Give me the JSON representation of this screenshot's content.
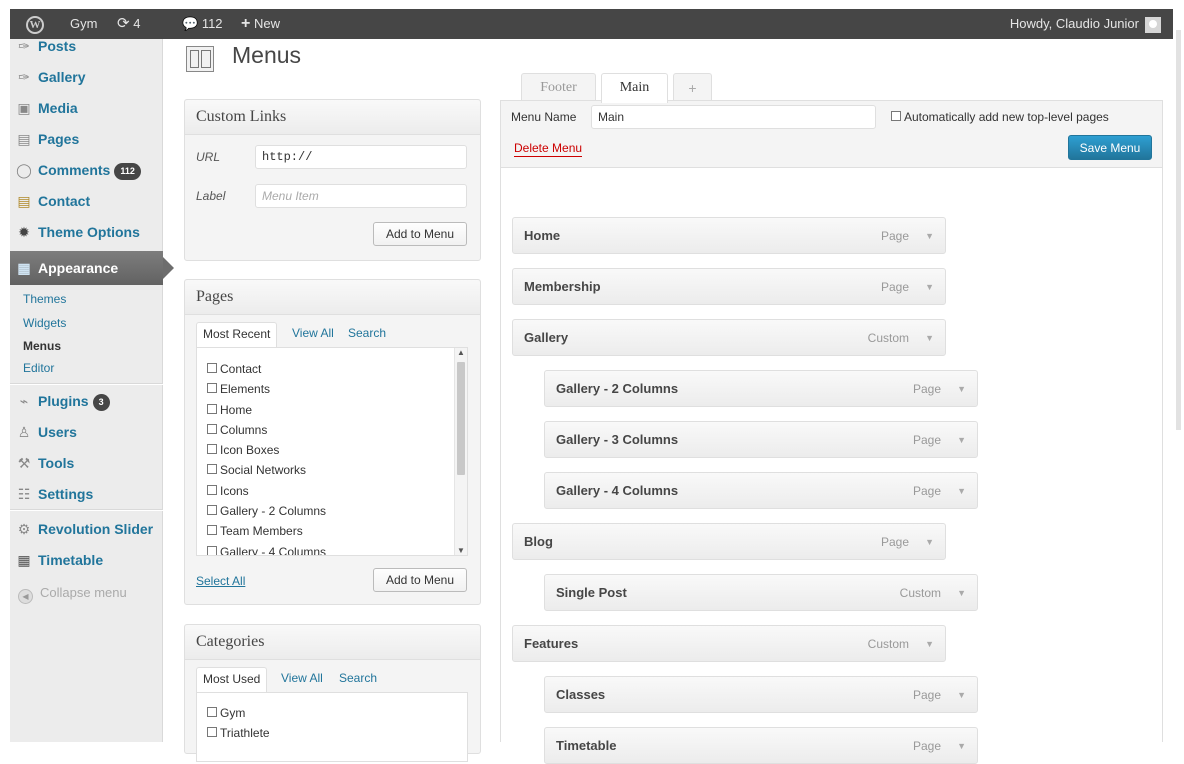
{
  "admin_bar": {
    "site_name": "Gym",
    "updates_count": "4",
    "comments_count": "112",
    "new_label": "New",
    "howdy": "Howdy, Claudio Junior"
  },
  "sidebar": {
    "items": [
      {
        "label": "Posts",
        "icon": "pushpin-icon"
      },
      {
        "label": "Gallery",
        "icon": "pushpin-icon"
      },
      {
        "label": "Media",
        "icon": "media-icon"
      },
      {
        "label": "Pages",
        "icon": "pages-icon"
      },
      {
        "label": "Comments",
        "icon": "comment-icon",
        "badge": "112"
      },
      {
        "label": "Contact",
        "icon": "contact-icon"
      },
      {
        "label": "Theme Options",
        "icon": "gear-icon"
      },
      {
        "label": "Appearance",
        "icon": "appearance-icon"
      },
      {
        "label": "Plugins",
        "icon": "plugin-icon",
        "badge": "3"
      },
      {
        "label": "Users",
        "icon": "users-icon"
      },
      {
        "label": "Tools",
        "icon": "tools-icon"
      },
      {
        "label": "Settings",
        "icon": "settings-icon"
      },
      {
        "label": "Revolution Slider",
        "icon": "cog-icon"
      },
      {
        "label": "Timetable",
        "icon": "calendar-icon"
      }
    ],
    "appearance_sub": [
      "Themes",
      "Widgets",
      "Menus",
      "Editor"
    ],
    "current_sub": "Menus",
    "collapse": "Collapse menu"
  },
  "page": {
    "title": "Menus"
  },
  "custom_links": {
    "title": "Custom Links",
    "url_label": "URL",
    "url_value": "http://",
    "label_label": "Label",
    "label_placeholder": "Menu Item",
    "add_button": "Add to Menu"
  },
  "pages_box": {
    "title": "Pages",
    "tabs": [
      "Most Recent",
      "View All",
      "Search"
    ],
    "items": [
      "Contact",
      "Elements",
      "Home",
      "Columns",
      "Icon Boxes",
      "Social Networks",
      "Icons",
      "Gallery - 2 Columns",
      "Team Members",
      "Gallery - 4 Columns"
    ],
    "select_all": "Select All",
    "add_button": "Add to Menu"
  },
  "categories_box": {
    "title": "Categories",
    "tabs": [
      "Most Used",
      "View All",
      "Search"
    ],
    "items": [
      "Gym",
      "Triathlete"
    ]
  },
  "menu_tabs": [
    "Footer",
    "Main",
    "+"
  ],
  "menu_editor": {
    "name_label": "Menu Name",
    "name_value": "Main",
    "auto_add": "Automatically add new top-level pages",
    "delete": "Delete Menu",
    "save": "Save Menu",
    "items": [
      {
        "title": "Home",
        "type": "Page",
        "depth": 0
      },
      {
        "title": "Membership",
        "type": "Page",
        "depth": 0
      },
      {
        "title": "Gallery",
        "type": "Custom",
        "depth": 0
      },
      {
        "title": "Gallery - 2 Columns",
        "type": "Page",
        "depth": 1
      },
      {
        "title": "Gallery - 3 Columns",
        "type": "Page",
        "depth": 1
      },
      {
        "title": "Gallery - 4 Columns",
        "type": "Page",
        "depth": 1
      },
      {
        "title": "Blog",
        "type": "Page",
        "depth": 0
      },
      {
        "title": "Single Post",
        "type": "Custom",
        "depth": 1
      },
      {
        "title": "Features",
        "type": "Custom",
        "depth": 0
      },
      {
        "title": "Classes",
        "type": "Page",
        "depth": 1
      },
      {
        "title": "Timetable",
        "type": "Page",
        "depth": 1
      }
    ]
  },
  "colors": {
    "link": "#21759b",
    "admin_bar": "#464646",
    "save_button": "#2a8bbc",
    "delete": "#cc0000"
  }
}
